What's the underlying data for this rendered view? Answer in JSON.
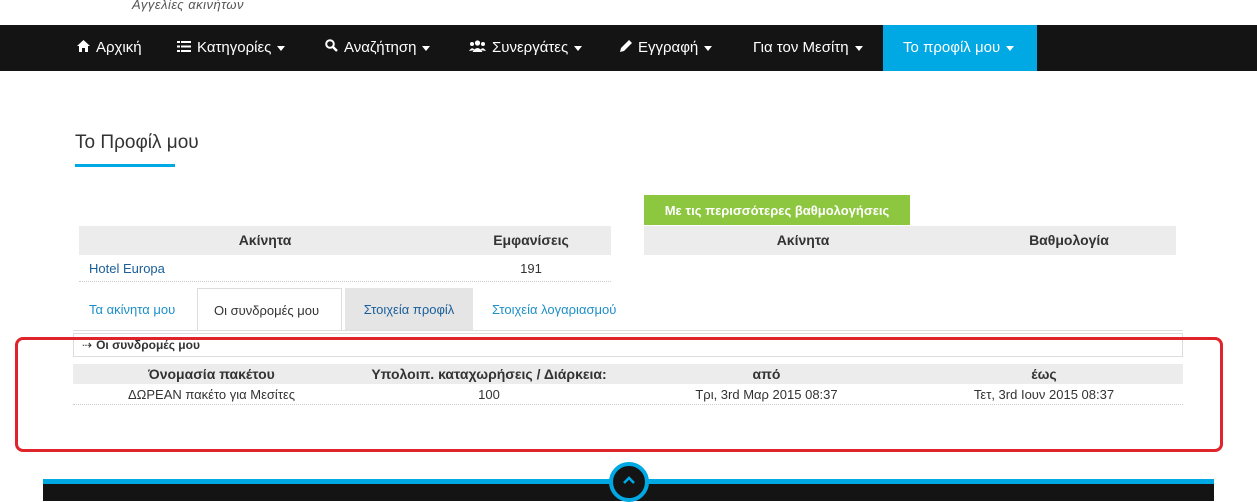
{
  "header": {
    "tagline": "Αγγελίες ακινήτων"
  },
  "nav": {
    "items": [
      {
        "label": "Αρχική",
        "icon": "home-icon"
      },
      {
        "label": "Κατηγορίες",
        "icon": "list-icon"
      },
      {
        "label": "Αναζήτηση",
        "icon": "search-icon"
      },
      {
        "label": "Συνεργάτες",
        "icon": "users-icon"
      },
      {
        "label": "Εγγραφή",
        "icon": "pencil-icon"
      },
      {
        "label": "Για τον Μεσίτη"
      },
      {
        "label": "Το προφίλ μου"
      }
    ],
    "active_color": "#00a9e4"
  },
  "page": {
    "title": "Το Προφίλ μου"
  },
  "views_table": {
    "headers": [
      "Ακίνητα",
      "Εμφανίσεις"
    ],
    "rows": [
      {
        "property": "Hotel Europa",
        "views": "191"
      }
    ]
  },
  "ratings_table": {
    "badge": "Με τις περισσότερες βαθμολογήσεις",
    "badge_color": "#8dc63f",
    "headers": [
      "Ακίνητα",
      "Βαθμολογία"
    ]
  },
  "tabs": [
    {
      "label": "Τα ακίνητα μου"
    },
    {
      "label": "Οι συνδρομές μου"
    },
    {
      "label": "Στοιχεία προφίλ"
    },
    {
      "label": "Στοιχεία λογαριασμού"
    }
  ],
  "subscriptions": {
    "section_title": "Οι συνδρομές μου",
    "headers": [
      "Όνομασία πακέτου",
      "Υπολοιπ. καταχωρήσεις / Διάρκεια:",
      "από",
      "έως"
    ],
    "rows": [
      {
        "name": "ΔΩΡΕΑΝ πακέτο για Μεσίτες",
        "remaining": "100",
        "from": "Τρι, 3rd Μαρ 2015 08:37",
        "to": "Τετ, 3rd Ιουν 2015 08:37"
      }
    ]
  },
  "highlight_color": "#e0242b"
}
